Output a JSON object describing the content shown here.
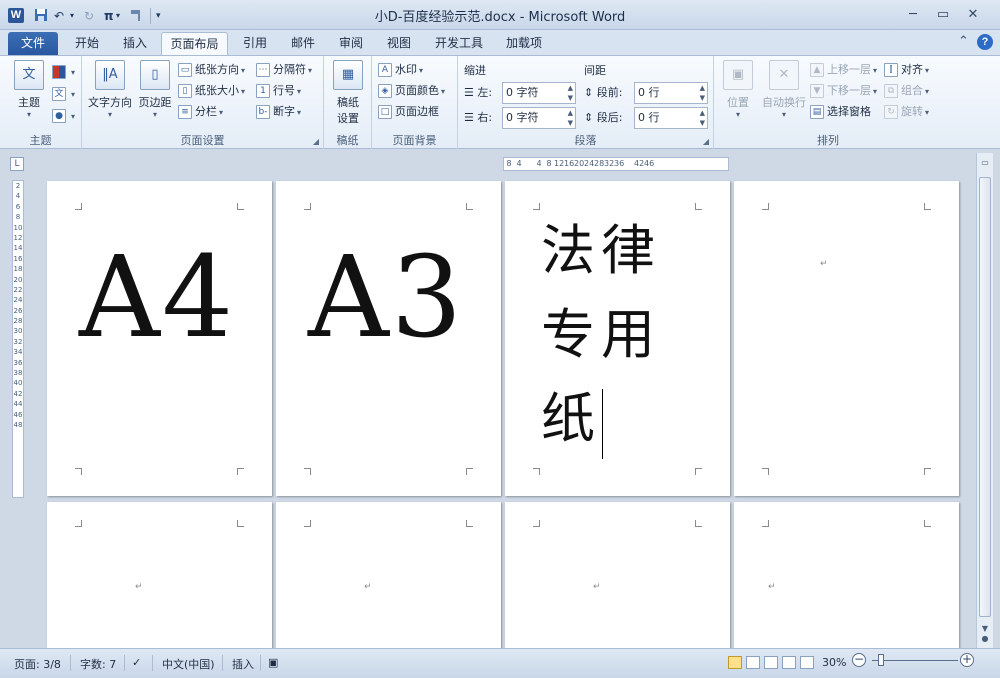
{
  "titlebar": {
    "app_icon": "W",
    "title": "小D-百度经验示范.docx - Microsoft Word",
    "quick_access": {
      "save": "save-icon",
      "undo": "↶",
      "redo": "↻",
      "equation": "π",
      "format_painter": "format-painter-icon",
      "customize": "▾"
    },
    "window_buttons": {
      "minimize": "─",
      "restore": "▭",
      "close": "✕"
    }
  },
  "tabs": [
    {
      "label": "文件"
    },
    {
      "label": "开始"
    },
    {
      "label": "插入"
    },
    {
      "label": "页面布局"
    },
    {
      "label": "引用"
    },
    {
      "label": "邮件"
    },
    {
      "label": "审阅"
    },
    {
      "label": "视图"
    },
    {
      "label": "开发工具"
    },
    {
      "label": "加载项"
    }
  ],
  "active_tab": "页面布局",
  "ribbon": {
    "theme": {
      "label": "主题",
      "button": "主题"
    },
    "page_setup": {
      "label": "页面设置",
      "text_direction": "文字方向",
      "margins": "页边距",
      "orientation": "纸张方向",
      "size": "纸张大小",
      "columns": "分栏",
      "breaks": "分隔符",
      "line_numbers": "行号",
      "hyphenation": "断字"
    },
    "manuscript": {
      "label": "稿纸",
      "button": "稿纸\n设置",
      "button_line1": "稿纸",
      "button_line2": "设置"
    },
    "page_background": {
      "label": "页面背景",
      "watermark": "水印",
      "page_color": "页面颜色",
      "page_borders": "页面边框"
    },
    "paragraph": {
      "label": "段落",
      "indent_title": "缩进",
      "spacing_title": "间距",
      "left_label": "左:",
      "left_value": "0 字符",
      "right_label": "右:",
      "right_value": "0 字符",
      "before_label": "段前:",
      "before_value": "0 行",
      "after_label": "段后:",
      "after_value": "0 行"
    },
    "arrange": {
      "label": "排列",
      "position": "位置",
      "wrap_text": "自动换行",
      "bring_forward": "上移一层",
      "send_backward": "下移一层",
      "selection_pane": "选择窗格",
      "align": "对齐",
      "group": "组合",
      "rotate": "旋转"
    }
  },
  "ruler": {
    "horizontal_ticks": [
      "8",
      "4",
      "",
      "4",
      "8",
      "12",
      "16",
      "20",
      "24",
      "28",
      "32",
      "36",
      "",
      "42",
      "46"
    ],
    "vertical_ticks": [
      "2",
      "4",
      "6",
      "8",
      "10",
      "12",
      "14",
      "16",
      "18",
      "20",
      "22",
      "24",
      "26",
      "28",
      "30",
      "32",
      "34",
      "36",
      "38",
      "40",
      "42",
      "44",
      "46",
      "48"
    ]
  },
  "pages": {
    "page1_text": "A4",
    "page2_text": "A3",
    "page3_line1": "法律",
    "page3_line2": "专用",
    "page3_line3": "纸",
    "paragraph_mark": "↵"
  },
  "status": {
    "page": "页面: 3/8",
    "words": "字数: 7",
    "language": "中文(中国)",
    "mode": "插入",
    "zoom": "30%",
    "zoom_minus": "−",
    "zoom_plus": "+"
  },
  "colors": {
    "accent": "#2b579a",
    "file_tab": "#2f62ab",
    "background": "#cfd9e6"
  }
}
